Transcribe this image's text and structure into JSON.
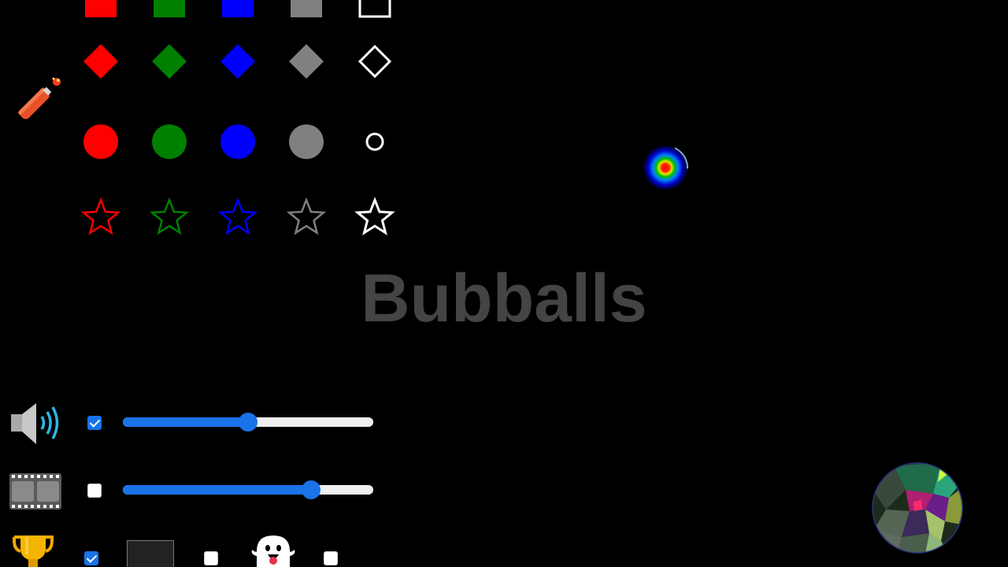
{
  "app": {
    "title": "Bubballs"
  },
  "shape_palette": {
    "colors": [
      "#ff0000",
      "#008000",
      "#0000ff",
      "#808080",
      "#ffffff"
    ],
    "rows": [
      "square",
      "diamond",
      "circle",
      "star"
    ]
  },
  "icons": {
    "dynamite": "dynamite-icon",
    "speaker": "speaker-icon",
    "film": "film-strip-icon",
    "trophy": "trophy-icon",
    "ghost": "ghost-icon"
  },
  "controls": {
    "sound": {
      "enabled": true,
      "volume": 0.5
    },
    "video": {
      "enabled": false,
      "level": 0.75
    },
    "trophy_checkbox": true,
    "color_checkbox": false,
    "ghost_checkbox": false
  },
  "accent_color": "#1a73e8"
}
